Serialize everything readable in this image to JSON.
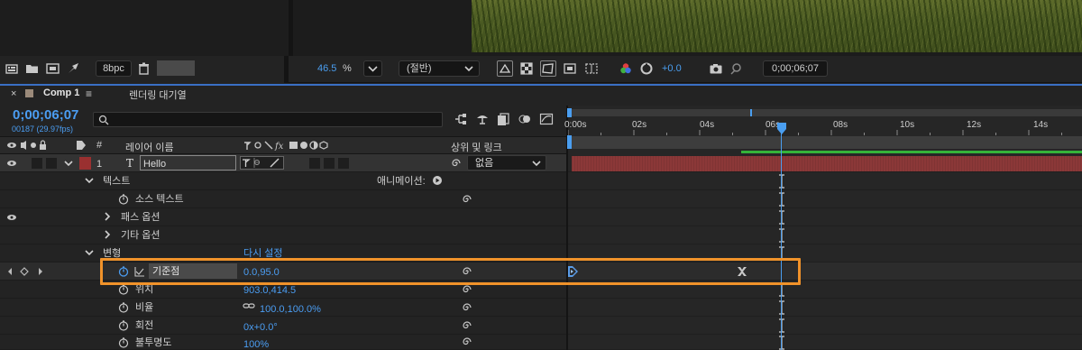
{
  "project_toolbar": {
    "bit_depth": "8bpc"
  },
  "viewer_toolbar": {
    "zoom_value": "46.5",
    "zoom_unit": "%",
    "resolution": "(절반)",
    "exposure": "+0.0",
    "timecode": "0;00;06;07"
  },
  "comp_tab": {
    "close": "×",
    "name": "Comp 1",
    "menu": "≡",
    "render_queue": "렌더링 대기열"
  },
  "timeline": {
    "current_time": "0;00;06;07",
    "frame_info": "00187 (29.97fps)",
    "search_placeholder": "",
    "ruler_labels": [
      "0:00s",
      "02s",
      "04s",
      "06s",
      "08s",
      "10s",
      "12s",
      "14s"
    ],
    "column_headers": {
      "hash": "#",
      "layer_name": "레이어 이름",
      "parent_link": "상위 및 링크"
    },
    "layer": {
      "number": "1",
      "type_icon": "T",
      "name": "Hello",
      "parent_value": "없음",
      "bar_color": "#9a3a3a"
    },
    "properties": {
      "text_group": "텍스트",
      "animate_label": "애니메이션:",
      "source_text": "소스 텍스트",
      "path_options": "패스 옵션",
      "more_options": "기타 옵션",
      "transform_group": "변형",
      "reset_label": "다시 설정",
      "anchor_point": "기준점",
      "anchor_value": "0.0,95.0",
      "position": "위치",
      "position_value": "903.0,414.5",
      "scale": "비율",
      "scale_value": "100.0,100.0%",
      "rotation": "회전",
      "rotation_value": "0x+0.0°",
      "opacity": "불투명도",
      "opacity_value": "100%"
    },
    "highlight_color": "#f0922a",
    "playhead_color": "#4a9ef0"
  }
}
